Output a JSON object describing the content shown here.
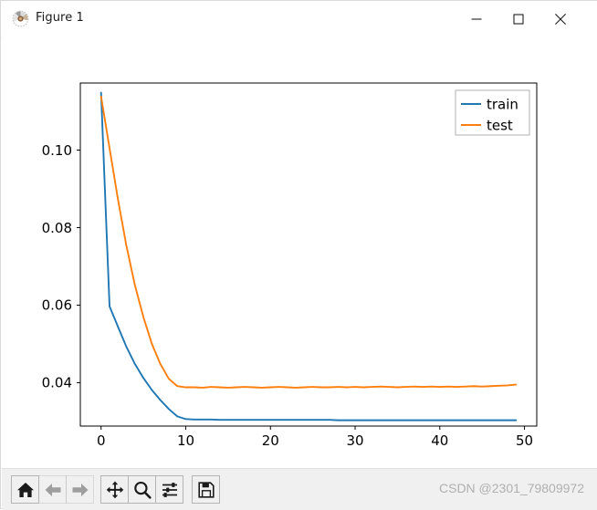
{
  "window": {
    "title": "Figure 1",
    "icon": "matplotlib-logo-icon",
    "controls": {
      "minimize": "minimize-icon",
      "maximize": "maximize-icon",
      "close": "close-icon"
    }
  },
  "toolbar": {
    "buttons": [
      {
        "name": "home-button",
        "tooltip": "Reset original view",
        "icon": "home-icon",
        "enabled": true
      },
      {
        "name": "back-button",
        "tooltip": "Back to previous view",
        "icon": "arrow-left-icon",
        "enabled": false
      },
      {
        "name": "forward-button",
        "tooltip": "Forward to next view",
        "icon": "arrow-right-icon",
        "enabled": false
      },
      {
        "name": "pan-button",
        "tooltip": "Pan axes with left mouse, zoom with right",
        "icon": "move-icon",
        "enabled": true
      },
      {
        "name": "zoom-button",
        "tooltip": "Zoom to rectangle",
        "icon": "magnifier-icon",
        "enabled": true
      },
      {
        "name": "subplots-button",
        "tooltip": "Configure subplots",
        "icon": "sliders-icon",
        "enabled": true
      },
      {
        "name": "save-button",
        "tooltip": "Save the figure",
        "icon": "floppy-disk-icon",
        "enabled": true
      }
    ],
    "watermark": "CSDN @2301_79809972"
  },
  "chart_data": {
    "type": "line",
    "title": "",
    "xlabel": "",
    "ylabel": "",
    "xlim": [
      -2.45,
      51.45
    ],
    "ylim": [
      0.0288,
      0.1173
    ],
    "xticks": [
      0,
      10,
      20,
      30,
      40,
      50
    ],
    "xticklabels": [
      "0",
      "10",
      "20",
      "30",
      "40",
      "50"
    ],
    "yticks": [
      0.04,
      0.06,
      0.08,
      0.1
    ],
    "yticklabels": [
      "0.04",
      "0.06",
      "0.08",
      "0.10"
    ],
    "grid": false,
    "legend_position": "upper right",
    "colors": {
      "train": "#1f77b4",
      "test": "#ff7f0e",
      "axes_edge": "#000000",
      "figure_background": "#ffffff",
      "axes_background": "#ffffff"
    },
    "x": [
      0,
      1,
      2,
      3,
      4,
      5,
      6,
      7,
      8,
      9,
      10,
      11,
      12,
      13,
      14,
      15,
      16,
      17,
      18,
      19,
      20,
      21,
      22,
      23,
      24,
      25,
      26,
      27,
      28,
      29,
      30,
      31,
      32,
      33,
      34,
      35,
      36,
      37,
      38,
      39,
      40,
      41,
      42,
      43,
      44,
      45,
      46,
      47,
      48,
      49
    ],
    "series": [
      {
        "name": "train",
        "label": "train",
        "color": "#1f77b4",
        "values": [
          0.1148,
          0.0597,
          0.0544,
          0.0492,
          0.0448,
          0.0412,
          0.0381,
          0.0355,
          0.0332,
          0.0313,
          0.0306,
          0.0305,
          0.0305,
          0.0305,
          0.0304,
          0.0304,
          0.0304,
          0.0304,
          0.0304,
          0.0304,
          0.0304,
          0.0304,
          0.0304,
          0.0304,
          0.0304,
          0.0304,
          0.0304,
          0.0304,
          0.0303,
          0.0303,
          0.0303,
          0.0303,
          0.0303,
          0.0303,
          0.0303,
          0.0303,
          0.0303,
          0.0303,
          0.0303,
          0.0303,
          0.0303,
          0.0303,
          0.0303,
          0.0303,
          0.0303,
          0.0303,
          0.0303,
          0.0303,
          0.0303,
          0.0303
        ]
      },
      {
        "name": "test",
        "label": "test",
        "color": "#ff7f0e",
        "values": [
          0.1138,
          0.1005,
          0.0872,
          0.0752,
          0.0651,
          0.0569,
          0.05,
          0.0448,
          0.041,
          0.0391,
          0.0388,
          0.0388,
          0.0387,
          0.0389,
          0.0388,
          0.0387,
          0.0388,
          0.0389,
          0.0388,
          0.0387,
          0.0388,
          0.0389,
          0.0388,
          0.0387,
          0.0388,
          0.0389,
          0.0388,
          0.0388,
          0.0389,
          0.0388,
          0.0389,
          0.0388,
          0.0389,
          0.039,
          0.0389,
          0.0388,
          0.0389,
          0.039,
          0.0389,
          0.039,
          0.0389,
          0.039,
          0.0389,
          0.039,
          0.0391,
          0.039,
          0.0391,
          0.0392,
          0.0393,
          0.0395
        ]
      }
    ]
  }
}
